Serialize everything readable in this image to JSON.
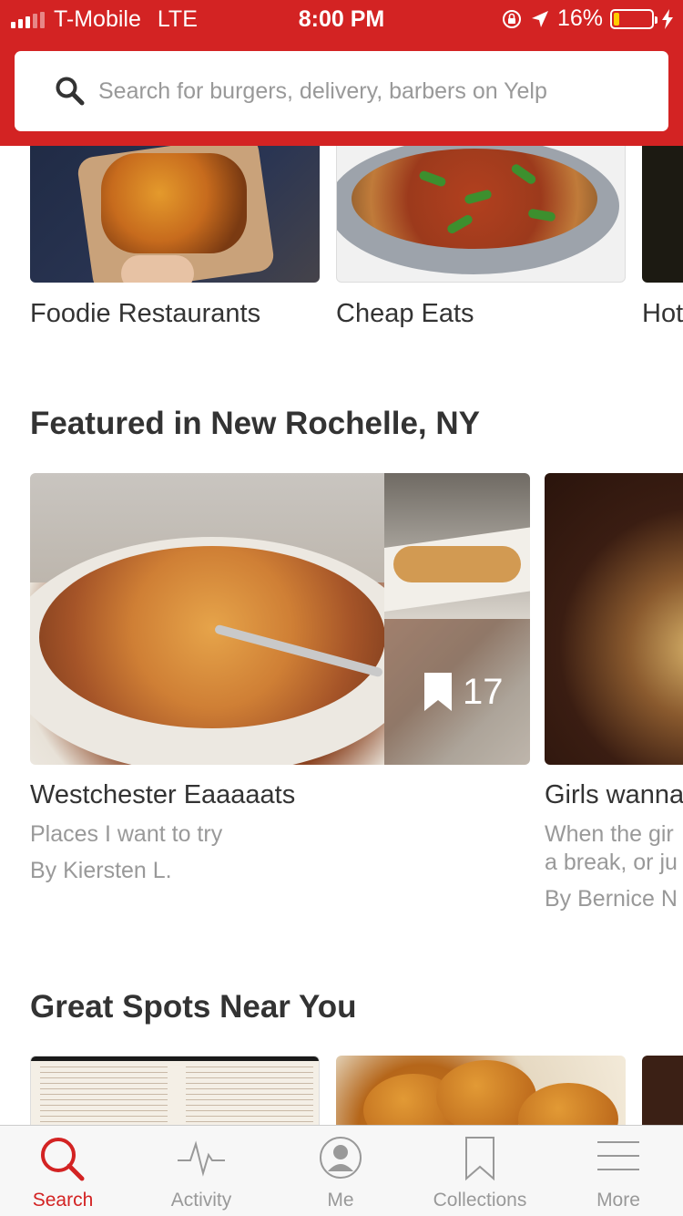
{
  "status_bar": {
    "carrier": "T-Mobile",
    "network": "LTE",
    "time": "8:00 PM",
    "battery_percent": "16%",
    "battery_level": 0.16
  },
  "search": {
    "placeholder": "Search for burgers, delivery, barbers on Yelp"
  },
  "categories": [
    {
      "label": "Foodie Restaurants"
    },
    {
      "label": "Cheap Eats"
    },
    {
      "label": "Hot"
    }
  ],
  "featured": {
    "title": "Featured in New Rochelle, NY",
    "collections": [
      {
        "title": "Westchester Eaaaaats",
        "description": "Places I want to try",
        "author": "By Kiersten L.",
        "bookmark_count": "17"
      },
      {
        "title": "Girls wanna",
        "description_line1": "When the gir",
        "description_line2": "a break, or ju",
        "author": "By Bernice N"
      }
    ]
  },
  "great_spots": {
    "title": "Great Spots Near You"
  },
  "tabs": [
    {
      "label": "Search",
      "icon": "search-icon",
      "active": true
    },
    {
      "label": "Activity",
      "icon": "activity-icon",
      "active": false
    },
    {
      "label": "Me",
      "icon": "profile-icon",
      "active": false
    },
    {
      "label": "Collections",
      "icon": "bookmark-icon",
      "active": false
    },
    {
      "label": "More",
      "icon": "menu-icon",
      "active": false
    }
  ],
  "colors": {
    "brand_red": "#d32323",
    "text_primary": "#333333",
    "text_secondary": "#999999",
    "battery_low": "#ffcc00"
  }
}
